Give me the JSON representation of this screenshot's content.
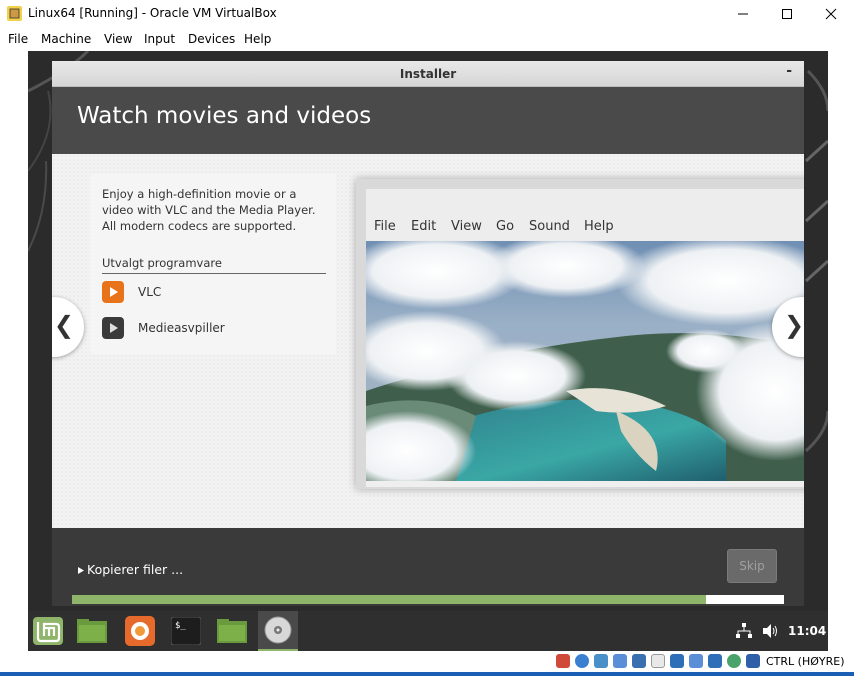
{
  "window": {
    "title": "Linux64 [Running] - Oracle VM VirtualBox"
  },
  "host_menu": [
    "File",
    "Machine",
    "View",
    "Input",
    "Devices",
    "Help"
  ],
  "installer": {
    "title": "Installer",
    "minimize_label": "-",
    "headline": "Watch movies and videos",
    "description": "Enjoy a high-definition movie or a video with VLC and the Media Player. All modern codecs are supported.",
    "selected_heading": "Utvalgt programvare",
    "apps": [
      {
        "label": "VLC",
        "icon": "vlc-icon"
      },
      {
        "label": "Medieasvpiller",
        "icon": "media-player-icon"
      }
    ],
    "nav_prev": "❮",
    "nav_next": "❯",
    "player_menu": [
      "File",
      "Edit",
      "View",
      "Go",
      "Sound",
      "Help"
    ],
    "status": "Kopierer filer ...",
    "skip_label": "Skip",
    "progress": 0.89
  },
  "panel": {
    "clock": "11:04"
  },
  "host_status": {
    "host_key": "CTRL (HØYRE)"
  },
  "colors": {
    "accent": "#8fb56b",
    "header": "#4a4a4a",
    "vlc": "#e8731a"
  }
}
